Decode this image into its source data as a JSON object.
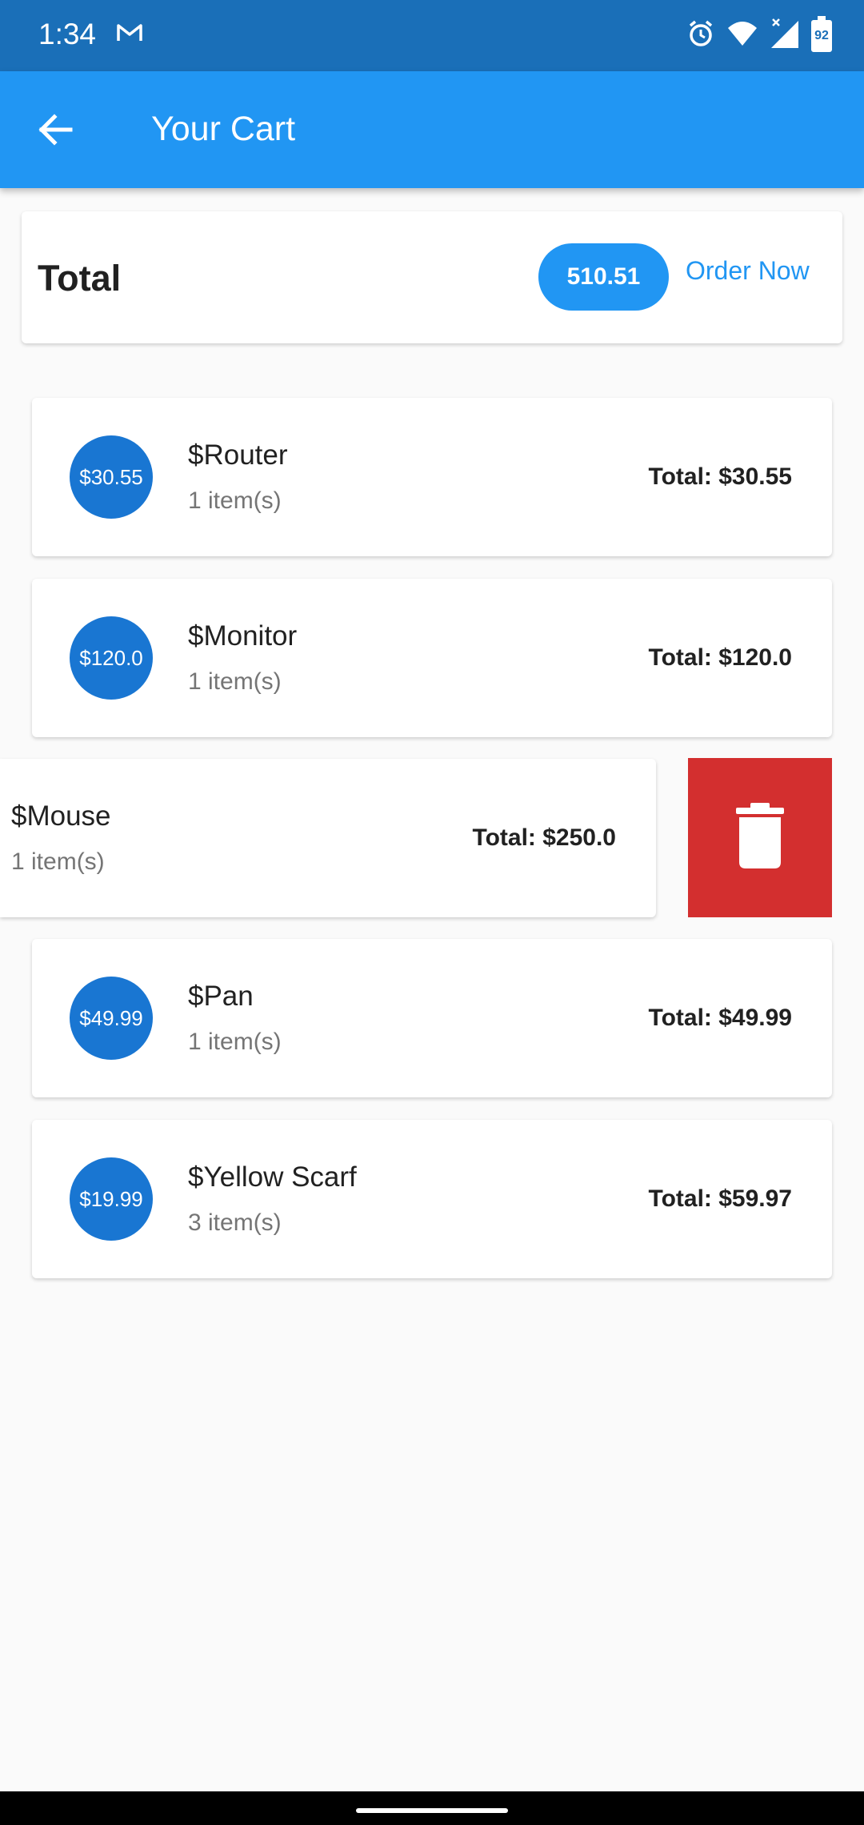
{
  "status_bar": {
    "time": "1:34",
    "battery": "92",
    "icons": [
      "gmail-icon",
      "alarm-icon",
      "wifi-icon",
      "signal-icon",
      "battery-icon"
    ]
  },
  "app_bar": {
    "title": "Your Cart",
    "back_icon": "arrow-back-icon"
  },
  "total_card": {
    "label": "Total",
    "amount": "510.51",
    "order_button": "Order Now"
  },
  "items": [
    {
      "avatar": "$30.55",
      "title": "$Router",
      "qty": "1 item(s)",
      "total": "Total: $30.55"
    },
    {
      "avatar": "$120.0",
      "title": "$Monitor",
      "qty": "1 item(s)",
      "total": "Total: $120.0"
    },
    {
      "avatar": "",
      "title": "$Mouse",
      "qty": "1 item(s)",
      "total": "Total: $250.0"
    },
    {
      "avatar": "$49.99",
      "title": "$Pan",
      "qty": "1 item(s)",
      "total": "Total: $49.99"
    },
    {
      "avatar": "$19.99",
      "title": "$Yellow Scarf",
      "qty": "3 item(s)",
      "total": "Total: $59.97"
    }
  ],
  "colors": {
    "status_bar": "#1a6fb8",
    "app_bar": "#2196f3",
    "avatar": "#1976d2",
    "delete": "#d32f2f"
  }
}
